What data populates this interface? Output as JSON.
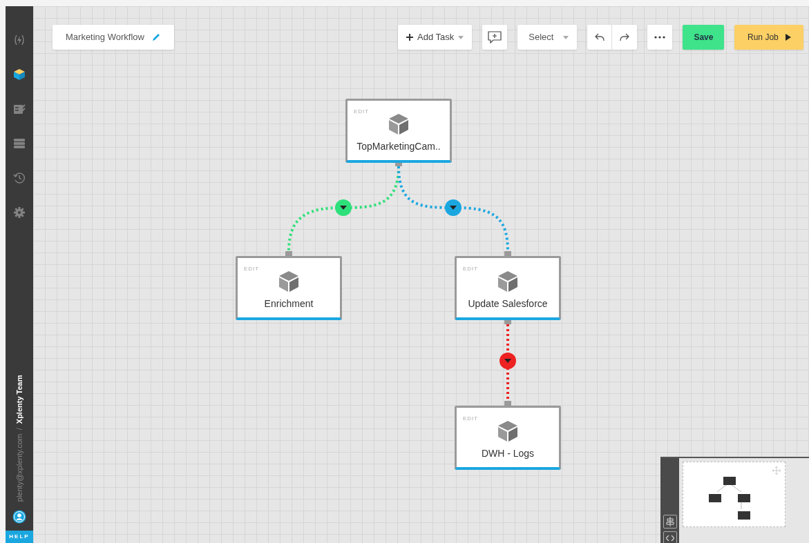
{
  "workflow": {
    "title": "Marketing Workflow"
  },
  "toolbar": {
    "add_task": "Add Task",
    "select": "Select",
    "save": "Save",
    "run_job": "Run Job"
  },
  "sidebar": {
    "items": [
      {
        "kind": "jobs",
        "selected": false
      },
      {
        "kind": "packages",
        "selected": true
      },
      {
        "kind": "tasks",
        "selected": false
      },
      {
        "kind": "connections",
        "selected": false
      },
      {
        "kind": "history",
        "selected": false
      },
      {
        "kind": "settings",
        "selected": false
      }
    ],
    "email": "plenty@xplenty.com",
    "separator": "/",
    "team": "Xplenty Team",
    "help": "HELP"
  },
  "nodes": [
    {
      "edit": "EDIT",
      "label": "TopMarketingCam.."
    },
    {
      "edit": "EDIT",
      "label": "Enrichment"
    },
    {
      "edit": "EDIT",
      "label": "Update Salesforce"
    },
    {
      "edit": "EDIT",
      "label": "DWH - Logs"
    }
  ],
  "connectors": [
    {
      "color": "#2ee07a"
    },
    {
      "color": "#1aa7e0"
    },
    {
      "color": "#ee2222"
    }
  ]
}
